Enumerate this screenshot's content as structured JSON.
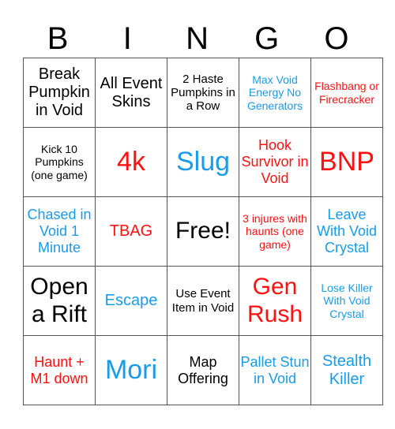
{
  "header": [
    "B",
    "I",
    "N",
    "G",
    "O"
  ],
  "colors": {
    "black": "#000000",
    "red": "#ff1111",
    "blue": "#1a9be8"
  },
  "rows": [
    [
      {
        "text": "Break Pumpkin in Void",
        "color": "black",
        "size": "lg"
      },
      {
        "text": "All Event Skins",
        "color": "black",
        "size": "lg"
      },
      {
        "text": "2 Haste Pumpkins in a Row",
        "color": "black",
        "size": "sm"
      },
      {
        "text": "Max Void Energy No Generators",
        "color": "blue",
        "size": "xs"
      },
      {
        "text": "Flashbang or Firecracker",
        "color": "red",
        "size": "xs"
      }
    ],
    [
      {
        "text": "Kick 10 Pumpkins (one game)",
        "color": "black",
        "size": "xs"
      },
      {
        "text": "4k",
        "color": "red",
        "size": "xxl"
      },
      {
        "text": "Slug",
        "color": "blue",
        "size": "xxl"
      },
      {
        "text": "Hook Survivor in Void",
        "color": "red",
        "size": "md"
      },
      {
        "text": "BNP",
        "color": "red",
        "size": "xxl"
      }
    ],
    [
      {
        "text": "Chased in Void 1 Minute",
        "color": "blue",
        "size": "md"
      },
      {
        "text": "TBAG",
        "color": "red",
        "size": "lg"
      },
      {
        "text": "Free!",
        "color": "black",
        "size": "xl"
      },
      {
        "text": "3 injures with haunts (one game)",
        "color": "red",
        "size": "xs"
      },
      {
        "text": "Leave With Void Crystal",
        "color": "blue",
        "size": "md"
      }
    ],
    [
      {
        "text": "Open a Rift",
        "color": "black",
        "size": "xl"
      },
      {
        "text": "Escape",
        "color": "blue",
        "size": "lg"
      },
      {
        "text": "Use Event Item in Void",
        "color": "black",
        "size": "sm"
      },
      {
        "text": "Gen Rush",
        "color": "red",
        "size": "xl"
      },
      {
        "text": "Lose Killer With Void Crystal",
        "color": "blue",
        "size": "xs"
      }
    ],
    [
      {
        "text": "Haunt + M1 down",
        "color": "red",
        "size": "md"
      },
      {
        "text": "Mori",
        "color": "blue",
        "size": "xxl"
      },
      {
        "text": "Map Offering",
        "color": "black",
        "size": "md"
      },
      {
        "text": "Pallet Stun in Void",
        "color": "blue",
        "size": "md"
      },
      {
        "text": "Stealth Killer",
        "color": "blue",
        "size": "lg"
      }
    ]
  ]
}
